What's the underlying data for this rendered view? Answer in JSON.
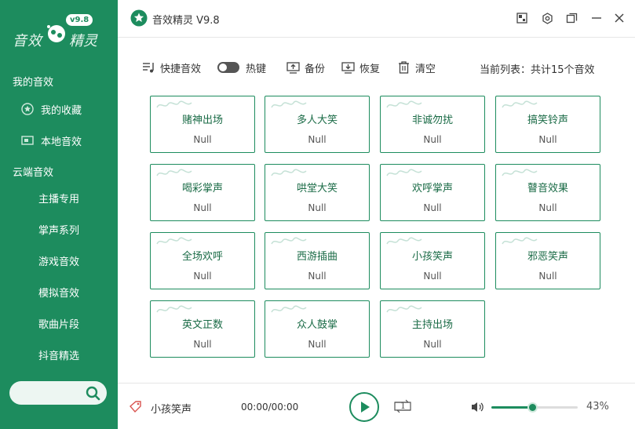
{
  "sidebar": {
    "logo_text_left": "音效",
    "logo_text_right": "精灵",
    "logo_badge": "v9.8",
    "section_my": "我的音效",
    "my_items": [
      {
        "label": "我的收藏",
        "icon": "star-icon"
      },
      {
        "label": "本地音效",
        "icon": "folder-icon"
      }
    ],
    "section_cloud": "云端音效",
    "cloud_items": [
      "主播专用",
      "掌声系列",
      "游戏音效",
      "模拟音效",
      "歌曲片段",
      "抖音精选"
    ],
    "search_placeholder": ""
  },
  "titlebar": {
    "title": "音效精灵 V9.8"
  },
  "toolbar": {
    "shortcut_label": "快捷音效",
    "hotkey_label": "热键",
    "hotkey_on": false,
    "backup_label": "备份",
    "restore_label": "恢复",
    "clear_label": "清空",
    "count_text": "当前列表：共计15个音效"
  },
  "cards": [
    {
      "name": "赌神出场",
      "hotkey": "Null"
    },
    {
      "name": "多人大笑",
      "hotkey": "Null"
    },
    {
      "name": "非诚勿扰",
      "hotkey": "Null"
    },
    {
      "name": "搞笑铃声",
      "hotkey": "Null"
    },
    {
      "name": "喝彩掌声",
      "hotkey": "Null"
    },
    {
      "name": "哄堂大笑",
      "hotkey": "Null"
    },
    {
      "name": "欢呼掌声",
      "hotkey": "Null"
    },
    {
      "name": "瞽音效果",
      "hotkey": "Null"
    },
    {
      "name": "全场欢呼",
      "hotkey": "Null"
    },
    {
      "name": "西游插曲",
      "hotkey": "Null"
    },
    {
      "name": "小孩笑声",
      "hotkey": "Null"
    },
    {
      "name": "邪恶笑声",
      "hotkey": "Null"
    },
    {
      "name": "英文正数",
      "hotkey": "Null"
    },
    {
      "name": "众人鼓掌",
      "hotkey": "Null"
    },
    {
      "name": "主持出场",
      "hotkey": "Null"
    }
  ],
  "player": {
    "track_name": "小孩笑声",
    "time": "00:00/00:00",
    "loop_badge": "1",
    "volume_percent": 43,
    "volume_text": "43%"
  },
  "colors": {
    "brand": "#1d8c5e"
  }
}
